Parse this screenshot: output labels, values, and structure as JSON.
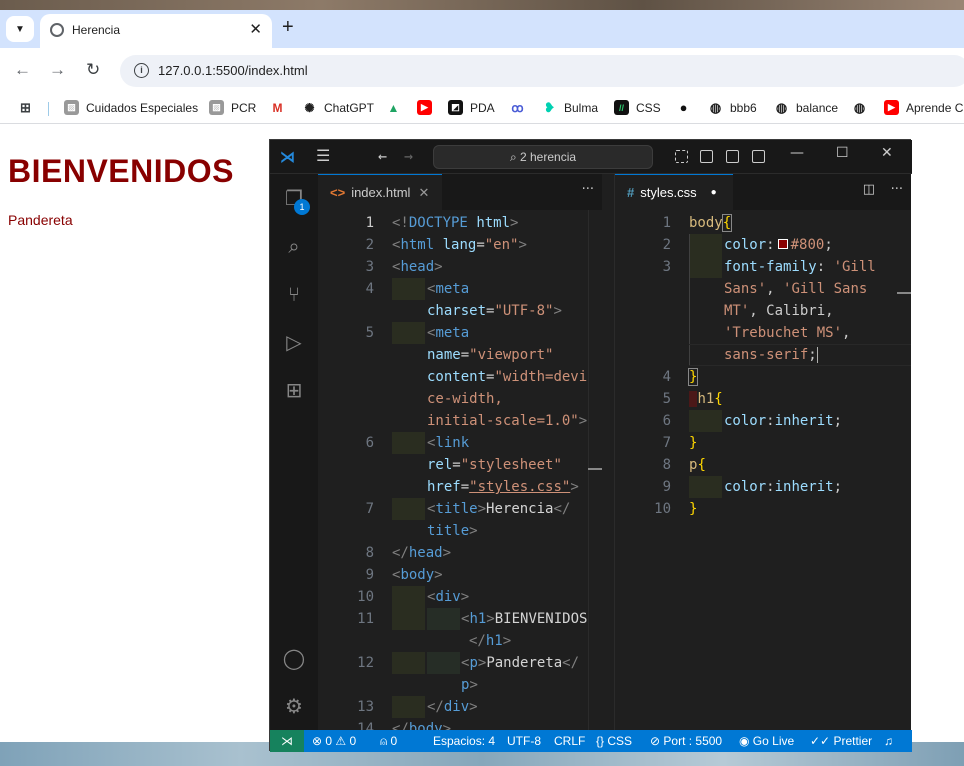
{
  "browser": {
    "tab_title": "Herencia",
    "url": "127.0.0.1:5500/index.html",
    "bookmarks": [
      "Cuidados Especiales",
      "PCR",
      "ChatGPT",
      "PDA",
      "Bulma",
      "CSS",
      "bbb6",
      "balance",
      "Aprende C"
    ]
  },
  "page": {
    "h1": "BIENVENIDOS",
    "p": "Pandereta"
  },
  "vscode": {
    "search": "2 herencia",
    "explorer_badge": "1",
    "editor1": {
      "tab": "index.html",
      "tab_icon": "<>"
    },
    "editor2": {
      "tab": "styles.css",
      "tab_icon": "#"
    },
    "status": {
      "problems": "⊗ 0 ⚠ 0",
      "ports": "⍝ 0",
      "spaces": "Espacios: 4",
      "encoding": "UTF-8",
      "eol": "CRLF",
      "language": "{} CSS",
      "port": "⊘ Port : 5500",
      "golive": "◉ Go Live",
      "prettier": "✓✓ Prettier"
    }
  },
  "colors": {
    "heading": "#880000",
    "accent": "#0078d4"
  }
}
